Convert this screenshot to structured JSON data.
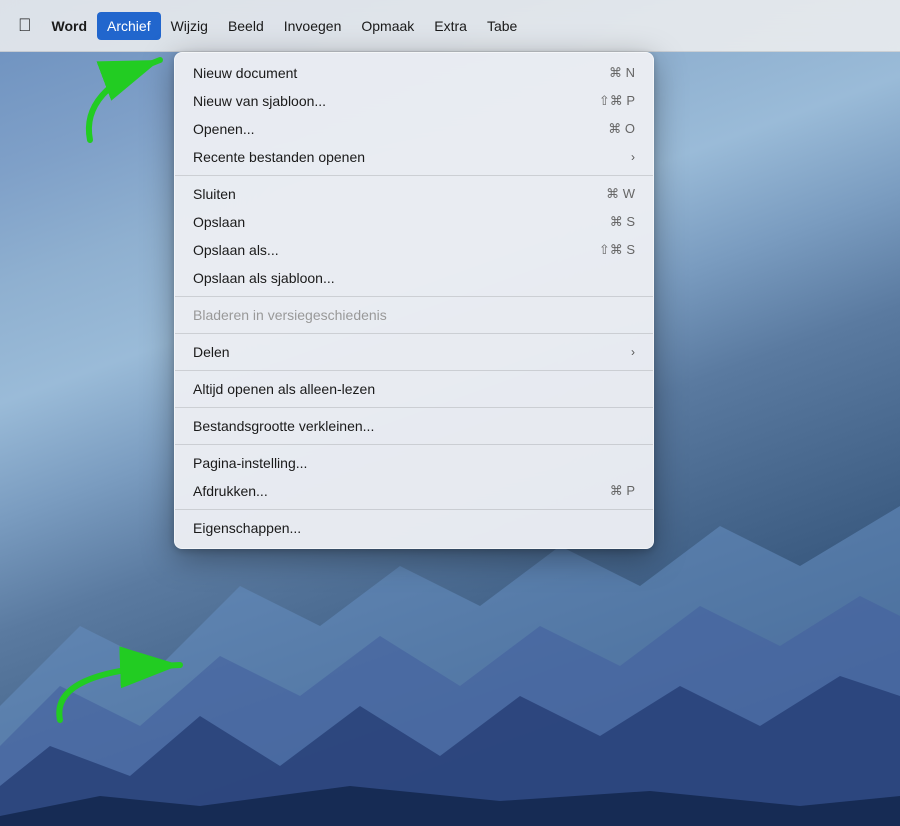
{
  "desktop": {
    "bg_description": "macOS Big Sur desktop"
  },
  "menubar": {
    "apple_label": "",
    "items": [
      {
        "id": "word",
        "label": "Word",
        "active": false,
        "bold": true
      },
      {
        "id": "archief",
        "label": "Archief",
        "active": true,
        "bold": false
      },
      {
        "id": "wijzig",
        "label": "Wijzig",
        "active": false,
        "bold": false
      },
      {
        "id": "beeld",
        "label": "Beeld",
        "active": false,
        "bold": false
      },
      {
        "id": "invoegen",
        "label": "Invoegen",
        "active": false,
        "bold": false
      },
      {
        "id": "opmaak",
        "label": "Opmaak",
        "active": false,
        "bold": false
      },
      {
        "id": "extra",
        "label": "Extra",
        "active": false,
        "bold": false
      },
      {
        "id": "tabe",
        "label": "Tabe",
        "active": false,
        "bold": false
      }
    ]
  },
  "dropdown": {
    "items": [
      {
        "id": "nieuw-document",
        "label": "Nieuw document",
        "shortcut": "⌘ N",
        "has_submenu": false,
        "disabled": false
      },
      {
        "id": "nieuw-sjabloon",
        "label": "Nieuw van sjabloon...",
        "shortcut": "⇧⌘ P",
        "has_submenu": false,
        "disabled": false
      },
      {
        "id": "openen",
        "label": "Openen...",
        "shortcut": "⌘ O",
        "has_submenu": false,
        "disabled": false
      },
      {
        "id": "recente-bestanden",
        "label": "Recente bestanden openen",
        "shortcut": "",
        "has_submenu": true,
        "disabled": false
      },
      {
        "separator_after": true
      },
      {
        "id": "sluiten",
        "label": "Sluiten",
        "shortcut": "⌘ W",
        "has_submenu": false,
        "disabled": false
      },
      {
        "id": "opslaan",
        "label": "Opslaan",
        "shortcut": "⌘ S",
        "has_submenu": false,
        "disabled": false
      },
      {
        "id": "opslaan-als",
        "label": "Opslaan als...",
        "shortcut": "⇧⌘ S",
        "has_submenu": false,
        "disabled": false
      },
      {
        "id": "opslaan-sjabloon",
        "label": "Opslaan als sjabloon...",
        "shortcut": "",
        "has_submenu": false,
        "disabled": false
      },
      {
        "separator_after": true
      },
      {
        "id": "bladeren",
        "label": "Bladeren in versiegeschiedenis",
        "shortcut": "",
        "has_submenu": false,
        "disabled": true
      },
      {
        "separator_after": true
      },
      {
        "id": "delen",
        "label": "Delen",
        "shortcut": "",
        "has_submenu": true,
        "disabled": false
      },
      {
        "separator_after": true
      },
      {
        "id": "alleen-lezen",
        "label": "Altijd openen als alleen-lezen",
        "shortcut": "",
        "has_submenu": false,
        "disabled": false
      },
      {
        "separator_after": true
      },
      {
        "id": "bestandsgrootte",
        "label": "Bestandsgrootte verkleinen...",
        "shortcut": "",
        "has_submenu": false,
        "disabled": false
      },
      {
        "separator_after": true
      },
      {
        "id": "pagina-instelling",
        "label": "Pagina-instelling...",
        "shortcut": "",
        "has_submenu": false,
        "disabled": false
      },
      {
        "id": "afdrukken",
        "label": "Afdrukken...",
        "shortcut": "⌘ P",
        "has_submenu": false,
        "disabled": false
      },
      {
        "separator_after": true
      },
      {
        "id": "eigenschappen",
        "label": "Eigenschappen...",
        "shortcut": "",
        "has_submenu": false,
        "disabled": false
      }
    ]
  },
  "arrows": {
    "top_direction": "pointing up-right toward Archief menu",
    "bottom_direction": "pointing right toward Pagina-instelling menu item"
  }
}
